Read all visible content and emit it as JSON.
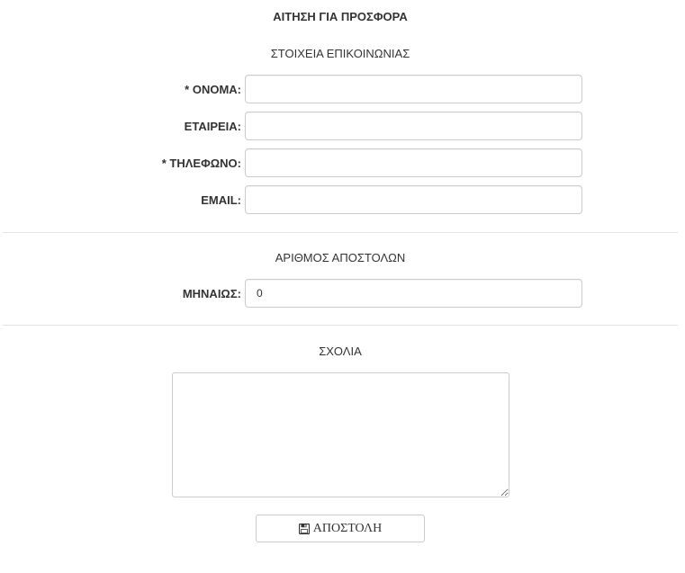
{
  "form": {
    "title": "ΑΙΤΗΣΗ ΓΙΑ ΠΡΟΣΦΟΡΑ"
  },
  "contact_section": {
    "heading": "ΣΤΟΙΧΕΙΑ ΕΠΙΚΟΙΝΩΝΙΑΣ",
    "name_label": "* ΟΝΟΜΑ:",
    "name_value": "",
    "company_label": "ΕΤΑΙΡΕΙΑ:",
    "company_value": "",
    "phone_label": "* ΤΗΛΕΦΩΝΟ:",
    "phone_value": "",
    "email_label": "EMAIL:",
    "email_value": ""
  },
  "shipments_section": {
    "heading": "ΑΡΙΘΜΟΣ ΑΠΟΣΤΟΛΩΝ",
    "monthly_label": "ΜΗΝΑΙΩΣ:",
    "monthly_value": "0"
  },
  "comments_section": {
    "heading": "ΣΧΟΛΙΑ",
    "value": ""
  },
  "submit": {
    "label": "ΑΠΟΣΤΟΛΗ",
    "icon": "floppy-disk-icon"
  }
}
